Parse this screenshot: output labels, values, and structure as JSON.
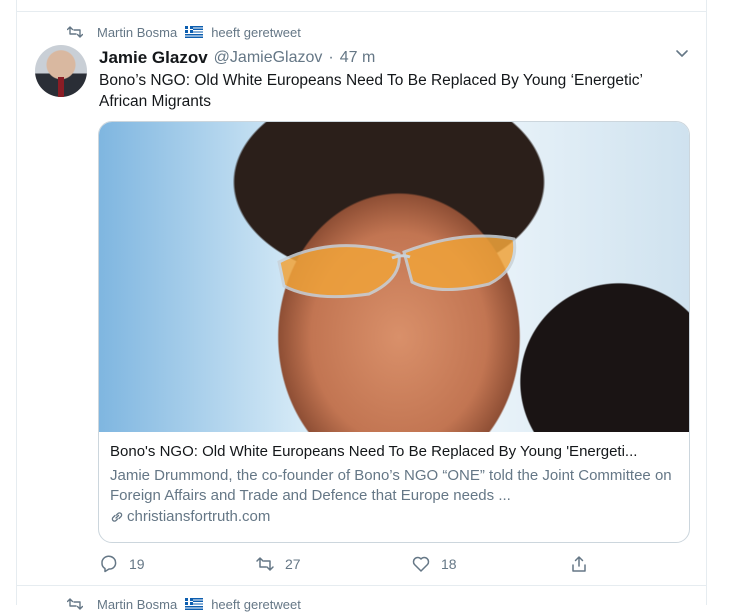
{
  "retweet": {
    "user": "Martin Bosma",
    "action": "heeft geretweet",
    "flag": "greek-flag"
  },
  "tweet": {
    "author_name": "Jamie Glazov",
    "author_handle": "@JamieGlazov",
    "separator": "·",
    "time": "47 m",
    "text": "Bono’s NGO: Old White Europeans Need To Be Replaced By Young ‘Energetic’ African Migrants",
    "card": {
      "title": "Bono's NGO: Old White Europeans Need To Be Replaced By Young 'Energeti...",
      "description": "Jamie Drummond, the co-founder of Bono’s NGO “ONE” told the Joint Committee on Foreign Affairs and Trade and Defence that Europe needs ...",
      "domain": "christiansfortruth.com"
    },
    "actions": {
      "replies": "19",
      "retweets": "27",
      "likes": "18"
    }
  },
  "next_retweet": {
    "user": "Martin Bosma",
    "action": "heeft geretweet"
  },
  "colors": {
    "secondary_text": "#657786",
    "border": "#e6ecf0",
    "card_border": "#ccd6dd"
  },
  "icons": [
    "retweet-icon",
    "chevron-down-icon",
    "link-icon",
    "reply-icon",
    "like-icon",
    "share-icon"
  ]
}
